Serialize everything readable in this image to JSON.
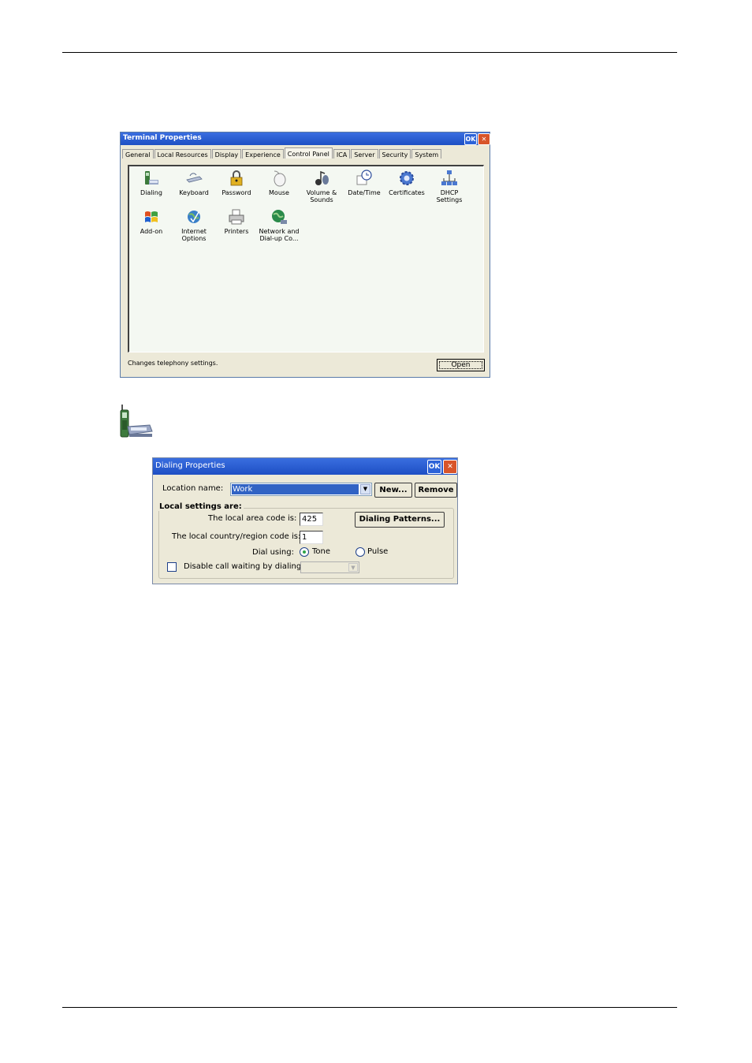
{
  "terminal_properties": {
    "title": "Terminal Properties",
    "ok_label": "OK",
    "close_label": "✕",
    "tabs": [
      "General",
      "Local Resources",
      "Display",
      "Experience",
      "Control Panel",
      "ICA",
      "Server",
      "Security",
      "System"
    ],
    "active_tab": "Control Panel",
    "items": [
      {
        "label": "Dialing",
        "icon": "dialing-icon"
      },
      {
        "label": "Keyboard",
        "icon": "keyboard-icon"
      },
      {
        "label": "Password",
        "icon": "password-icon"
      },
      {
        "label": "Mouse",
        "icon": "mouse-icon"
      },
      {
        "label": "Volume & Sounds",
        "icon": "volume-sounds-icon"
      },
      {
        "label": "Date/Time",
        "icon": "date-time-icon"
      },
      {
        "label": "Certificates",
        "icon": "certificates-icon"
      },
      {
        "label": "DHCP Settings",
        "icon": "dhcp-settings-icon"
      },
      {
        "label": "Add-on",
        "icon": "add-on-icon"
      },
      {
        "label": "Internet Options",
        "icon": "internet-options-icon"
      },
      {
        "label": "Printers",
        "icon": "printers-icon"
      },
      {
        "label": "Network and Dial-up Co...",
        "icon": "network-dialup-icon"
      }
    ],
    "status_text": "Changes telephony settings.",
    "open_label": "Open"
  },
  "dialing_properties": {
    "title": "Dialing Properties",
    "ok_label": "OK",
    "close_label": "✕",
    "location_label": "Location name:",
    "location_value": "Work",
    "new_label": "New...",
    "remove_label": "Remove",
    "group_label": "Local settings are:",
    "area_code_label": "The local area code is:",
    "area_code_value": "425",
    "dialing_patterns_label": "Dialing Patterns...",
    "country_code_label": "The local country/region code is:",
    "country_code_value": "1",
    "dial_using_label": "Dial using:",
    "tone_label": "Tone",
    "pulse_label": "Pulse",
    "dial_mode": "Tone",
    "call_waiting_label": "Disable call waiting by dialing:",
    "call_waiting_checked": false
  }
}
